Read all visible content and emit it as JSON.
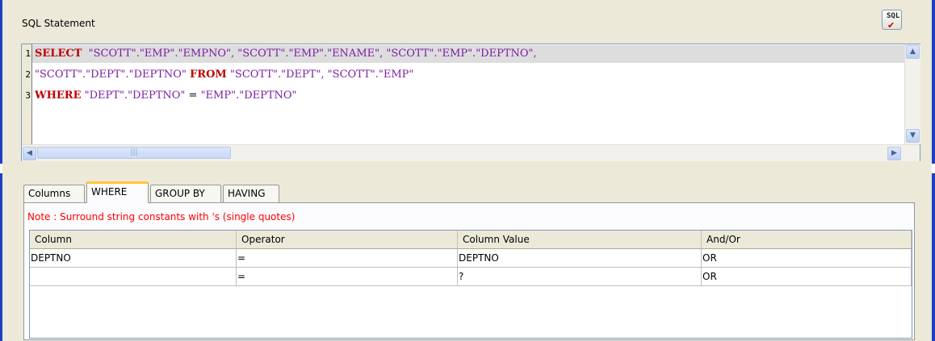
{
  "sql_panel": {
    "title": "SQL Statement",
    "sql_button_icon": "sql-check-icon",
    "sql_button_label": "SQL",
    "sql_button_mark": "✔",
    "lines": [
      {
        "num": "1",
        "kw1": "SELECT",
        "text1": "  \"SCOTT\".\"EMP\".\"EMPNO\", \"SCOTT\".\"EMP\".\"ENAME\", \"SCOTT\".\"EMP\".\"DEPTNO\","
      },
      {
        "num": "2",
        "text1": "\"SCOTT\".\"DEPT\".\"DEPTNO\" ",
        "kw1": "FROM",
        "text2": " \"SCOTT\".\"DEPT\", \"SCOTT\".\"EMP\""
      },
      {
        "num": "3",
        "kw1": "WHERE",
        "text1": " \"DEPT\".\"DEPTNO\"",
        "op": " = ",
        "text2": "\"EMP\".\"DEPTNO\""
      }
    ]
  },
  "tabs": [
    {
      "label": "Columns"
    },
    {
      "label": "WHERE",
      "active": true
    },
    {
      "label": "GROUP BY"
    },
    {
      "label": "HAVING"
    }
  ],
  "where": {
    "note": "Note : Surround string constants with 's (single quotes)",
    "columns": [
      "Column",
      "Operator",
      "Column Value",
      "And/Or"
    ],
    "rows": [
      [
        "DEPTNO",
        "=",
        "DEPTNO",
        "OR"
      ],
      [
        "",
        "=",
        "?",
        "OR"
      ]
    ]
  },
  "colors": {
    "keyword": "#c00000",
    "identifier": "#7b1fa2",
    "note": "#ff0000",
    "window_edge": "#1c3fc4"
  }
}
